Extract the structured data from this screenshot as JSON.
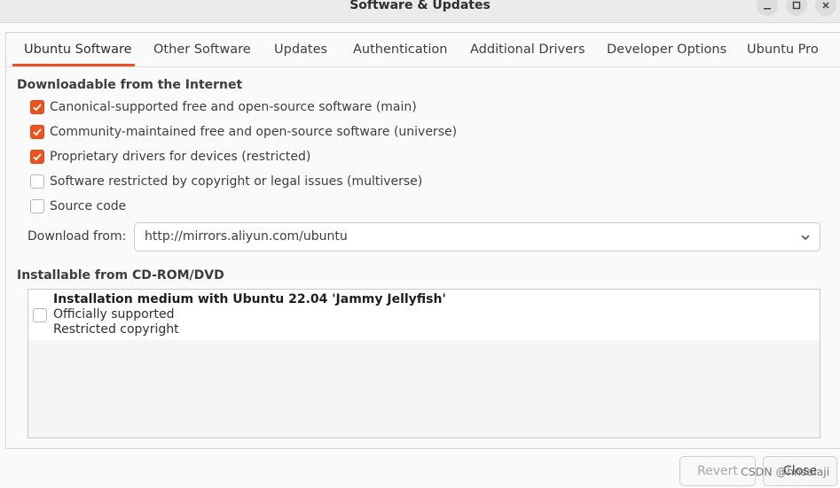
{
  "window": {
    "title": "Software & Updates"
  },
  "tabs": [
    {
      "label": "Ubuntu Software"
    },
    {
      "label": "Other Software"
    },
    {
      "label": "Updates"
    },
    {
      "label": "Authentication"
    },
    {
      "label": "Additional Drivers"
    },
    {
      "label": "Developer Options"
    },
    {
      "label": "Ubuntu Pro"
    }
  ],
  "internet": {
    "title": "Downloadable from the Internet",
    "options": [
      {
        "label": "Canonical-supported free and open-source software (main)",
        "checked": true
      },
      {
        "label": "Community-maintained free and open-source software (universe)",
        "checked": true
      },
      {
        "label": "Proprietary drivers for devices (restricted)",
        "checked": true
      },
      {
        "label": "Software restricted by copyright or legal issues (multiverse)",
        "checked": false
      },
      {
        "label": "Source code",
        "checked": false
      }
    ],
    "download_label": "Download from:",
    "download_value": "http://mirrors.aliyun.com/ubuntu"
  },
  "cdrom": {
    "title": "Installable from CD-ROM/DVD",
    "items": [
      {
        "title": "Installation medium with Ubuntu 22.04 'Jammy Jellyfish'",
        "line1": "Officially supported",
        "line2": "Restricted copyright",
        "checked": false
      }
    ]
  },
  "buttons": {
    "revert": "Revert",
    "close": "Close"
  },
  "watermark": "CSDN @hnsaiaji",
  "colors": {
    "accent": "#e95420"
  }
}
